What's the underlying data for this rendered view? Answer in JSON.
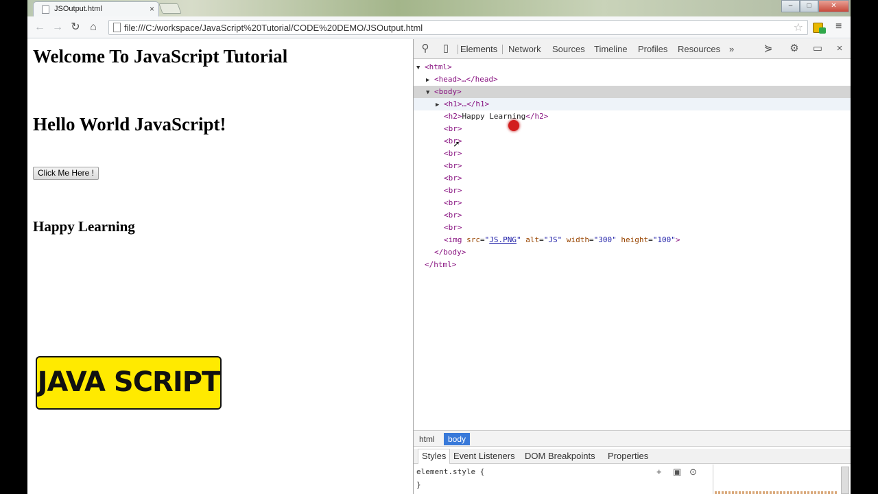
{
  "browser": {
    "tab_title": "JSOutput.html",
    "tab_close": "×",
    "url": "file:///C:/workspace/JavaScript%20Tutorial/CODE%20DEMO/JSOutput.html",
    "star": "☆",
    "menu": "≡",
    "win_min": "–",
    "win_max": "□",
    "win_close": "✕"
  },
  "page": {
    "heading1": "Welcome To JavaScript Tutorial",
    "heading2": "Hello World JavaScript!",
    "button_label": "Click Me Here !",
    "heading3": "Happy Learning",
    "logo_text": "JAVA SCRIPT",
    "logo_color": "#ffea00"
  },
  "devtools": {
    "tabs": [
      "Elements",
      "Network",
      "Sources",
      "Timeline",
      "Profiles",
      "Resources",
      "»"
    ],
    "dom": {
      "html_open": "<html>",
      "head": "<head>…</head>",
      "body_open": "<body>",
      "h1": "<h1>…</h1>",
      "h2_open": "<h2>",
      "h2_text": "Happy Learning",
      "h2_close": "</h2>",
      "br": "<br>",
      "img_tag": "<img",
      "img_src_name": "src",
      "img_src_val": "JS.PNG",
      "img_alt_name": "alt",
      "img_alt_val": "\"JS\"",
      "img_width_name": "width",
      "img_width_val": "\"300\"",
      "img_height_name": "height",
      "img_height_val": "\"100\"",
      "img_end": ">",
      "body_close": "</body>",
      "html_close": "</html>"
    },
    "breadcrumbs": [
      "html",
      "body"
    ],
    "sub_tabs": [
      "Styles",
      "Event Listeners",
      "DOM Breakpoints",
      "Properties"
    ],
    "styles_line1": "element.style {",
    "styles_line2": "}"
  }
}
